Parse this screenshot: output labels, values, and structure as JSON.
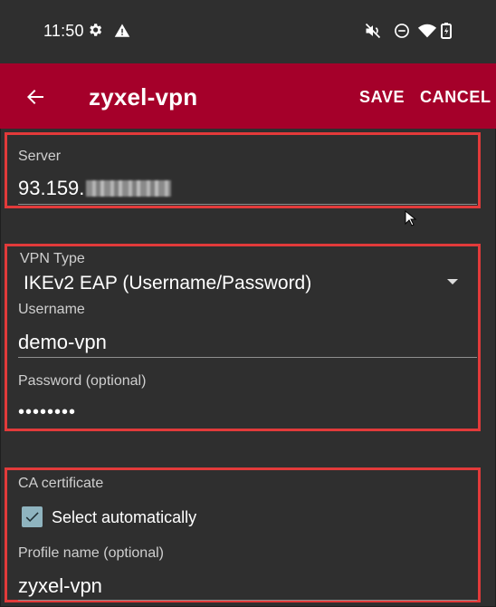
{
  "status_bar": {
    "time": "11:50",
    "icons": [
      "gear-icon",
      "warning-icon",
      "mute-icon",
      "do-not-disturb-icon",
      "wifi-icon",
      "battery-icon"
    ]
  },
  "app_bar": {
    "title": "zyxel-vpn",
    "save_label": "SAVE",
    "cancel_label": "CANCEL",
    "accent_color": "#a5002a"
  },
  "form": {
    "server": {
      "label": "Server",
      "value_visible": "93.159."
    },
    "vpn_type": {
      "label": "VPN Type",
      "selected": "IKEv2 EAP (Username/Password)"
    },
    "username": {
      "label": "Username",
      "value": "demo-vpn"
    },
    "password": {
      "label": "Password (optional)",
      "value": "••••••••"
    },
    "ca_certificate": {
      "label": "CA certificate",
      "select_automatically_label": "Select automatically",
      "select_automatically_checked": true
    },
    "profile_name": {
      "label": "Profile name (optional)",
      "value": "zyxel-vpn"
    }
  },
  "colors": {
    "background": "#2f2f2f",
    "highlight": "#e23a3a",
    "checkbox": "#8fb4bf"
  }
}
